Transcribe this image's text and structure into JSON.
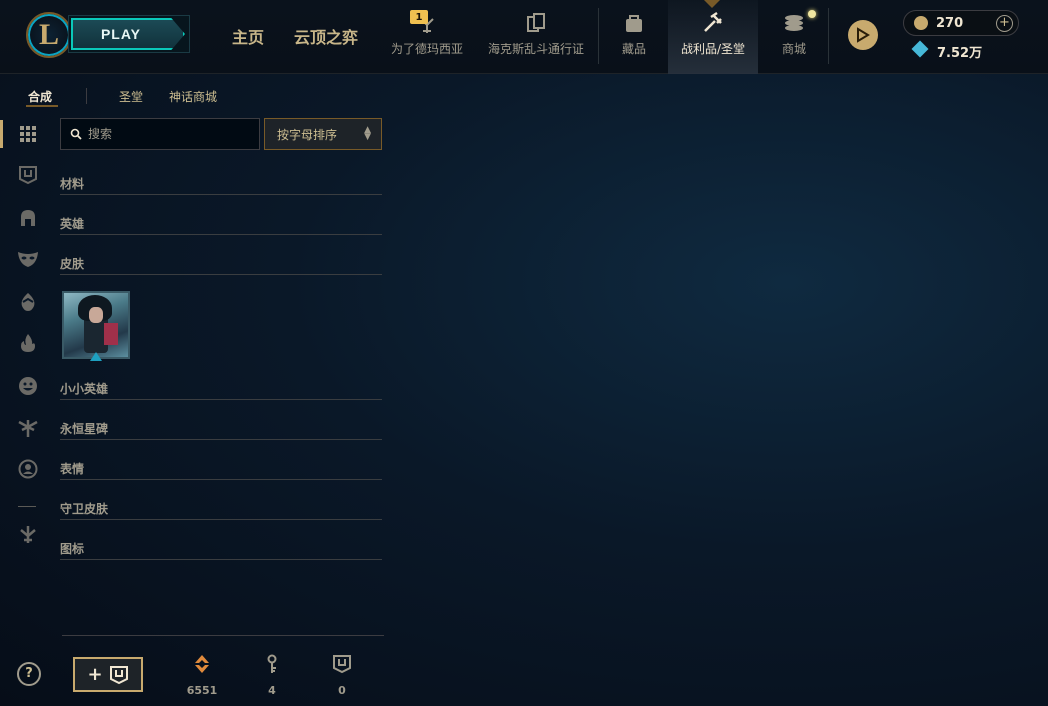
{
  "header": {
    "logo_text": "L",
    "play_label": "PLAY",
    "nav_main": [
      "主页",
      "云顶之弈"
    ],
    "nav_items": [
      {
        "label": "为了德玛西亚",
        "badge": "1"
      },
      {
        "label": "海克斯乱斗通行证"
      },
      {
        "label": "藏品"
      },
      {
        "label": "战利品/圣堂"
      },
      {
        "label": "商城"
      }
    ],
    "rp_value": "270",
    "plus_label": "+",
    "be_value": "7.52万"
  },
  "subnav": {
    "tabs": [
      "合成",
      "圣堂",
      "神话商城"
    ]
  },
  "search": {
    "placeholder": "搜索"
  },
  "sort": {
    "label": "按字母排序"
  },
  "categories": [
    "材料",
    "英雄",
    "皮肤",
    "小小英雄",
    "永恒星碑",
    "表情",
    "守卫皮肤",
    "图标"
  ],
  "bottom": {
    "help_label": "?",
    "craft_label": "+",
    "resources": [
      {
        "name": "orange-essence-icon",
        "value": "6551"
      },
      {
        "name": "key-icon",
        "value": "4"
      },
      {
        "name": "chest-icon",
        "value": "0"
      }
    ]
  },
  "colors": {
    "gold": "#c8aa6e",
    "teal": "#0ac8b9",
    "background": "#0a1828"
  }
}
